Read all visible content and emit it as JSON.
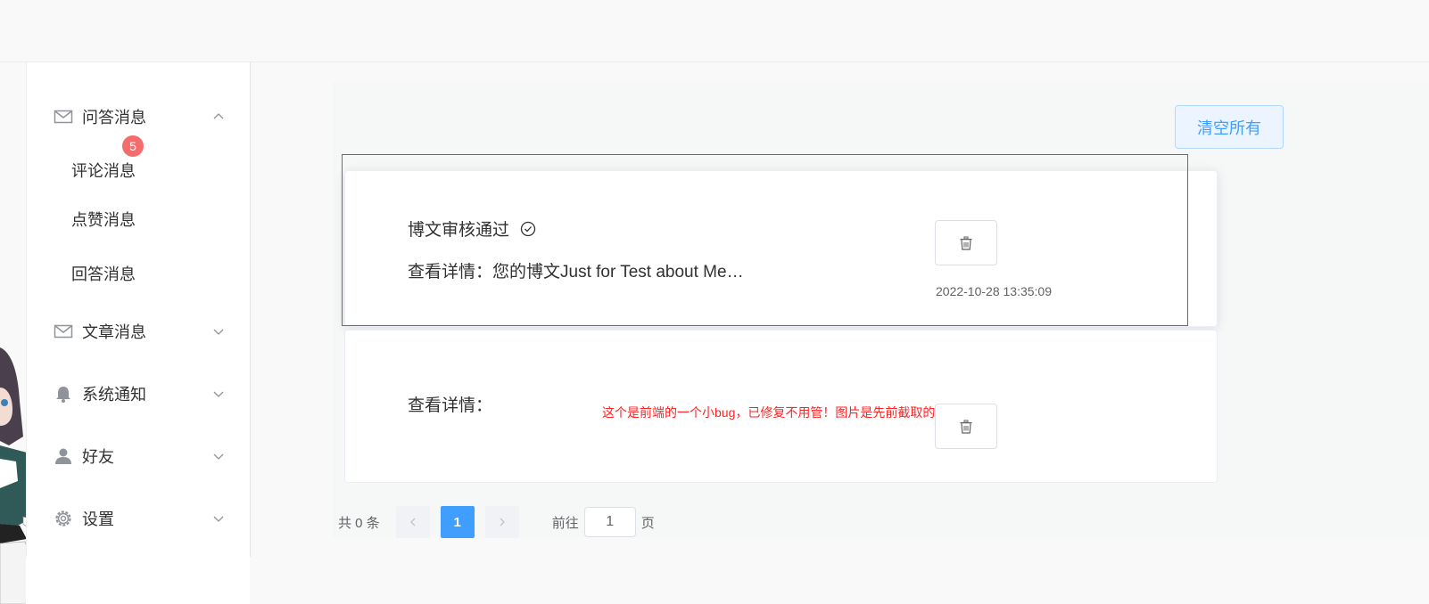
{
  "sidebar": {
    "groups": [
      {
        "label": "问答消息",
        "icon": "envelope-icon",
        "expanded": true
      },
      {
        "label": "文章消息",
        "icon": "envelope-icon",
        "expanded": false
      },
      {
        "label": "系统通知",
        "icon": "bell-icon",
        "expanded": false
      },
      {
        "label": "好友",
        "icon": "user-icon",
        "expanded": false
      },
      {
        "label": "设置",
        "icon": "gear-icon",
        "expanded": false
      }
    ],
    "sub_items": [
      {
        "label": "评论消息",
        "badge": "5"
      },
      {
        "label": "点赞消息"
      },
      {
        "label": "回答消息"
      }
    ]
  },
  "toolbar": {
    "clear_all_label": "清空所有"
  },
  "messages": [
    {
      "title": "博文审核通过",
      "detail": "查看详情：您的博文Just for Test about Me…",
      "time": "2022-10-28 13:35:09"
    },
    {
      "title": "",
      "detail": "查看详情：",
      "time": ""
    }
  ],
  "annotation": "这个是前端的一个小bug，已修复不用管！图片是先前截取的",
  "pagination": {
    "total_label": "共 0 条",
    "current_page": "1",
    "goto_label": "前往",
    "goto_value": "1",
    "page_suffix": "页"
  },
  "colors": {
    "accent": "#409eff",
    "badge": "#f56c6c",
    "annotation": "#ee3535"
  }
}
